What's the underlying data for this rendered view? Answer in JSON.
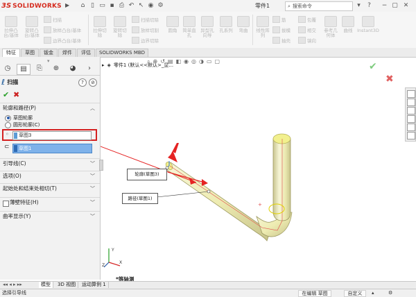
{
  "app": {
    "logo_ds": "3S",
    "logo_text": "SOLIDWORKS",
    "doc_title": "零件1",
    "search_placeholder": "搜索命令"
  },
  "ribbon": {
    "buttons": [
      {
        "label": "拉伸凸\n台/基体"
      },
      {
        "label": "旋转凸\n台/基体"
      },
      {
        "label": "拉伸切\n除"
      },
      {
        "label": "旋转切\n除"
      },
      {
        "label": "圆角"
      },
      {
        "label": "线性阵\n列"
      },
      {
        "label": "筋"
      },
      {
        "label": "参考几\n何体"
      },
      {
        "label": "曲线"
      },
      {
        "label": "Instant3D"
      },
      {
        "label": "简单直\n孔"
      },
      {
        "label": "异型孔\n向导"
      },
      {
        "label": "孔系列"
      },
      {
        "label": "弯曲"
      }
    ],
    "small_buttons": [
      {
        "label": "扫描"
      },
      {
        "label": "放样凸台/基体"
      },
      {
        "label": "边界凸台/基体"
      },
      {
        "label": "扫描切除"
      },
      {
        "label": "放样切割"
      },
      {
        "label": "边界切除"
      },
      {
        "label": "拔模"
      },
      {
        "label": "抽壳"
      },
      {
        "label": "包覆"
      },
      {
        "label": "相交"
      },
      {
        "label": "镜向"
      }
    ]
  },
  "tabs": [
    "特征",
    "草图",
    "钣金",
    "焊件",
    "评估",
    "SOLIDWORKS MBD"
  ],
  "panel": {
    "feature_title": "扫描",
    "sections": {
      "profile_path": "轮廓和路径(P)",
      "guide_curves": "引导线(C)",
      "options": "选项(O)",
      "start_end": "起始处和结束处相切(T)",
      "thin_feature": "薄壁特征(H)",
      "curvature": "曲率显示(Y)"
    },
    "radio_sketch_profile": "草图轮廓",
    "radio_circular_profile": "圆形轮廓(C)",
    "profile_value": "草图3",
    "path_value": "草图1"
  },
  "graphics": {
    "breadcrumb": "零件1 (默认<<默认>_显...",
    "callout_profile": "轮廓(草图3)",
    "callout_path": "路径(草图1)",
    "view_label": "*等轴测"
  },
  "model_tabs": [
    "模型",
    "3D 视图",
    "运动算例 1"
  ],
  "status": {
    "left_text": "选择引导线",
    "editing": "在编辑 草图",
    "custom": "自定义"
  },
  "colors": {
    "brand_red": "#d52b1e",
    "highlight_red": "#d42020",
    "selection_blue": "#7fb2ea",
    "part_yellow": "#f0eeb8"
  }
}
